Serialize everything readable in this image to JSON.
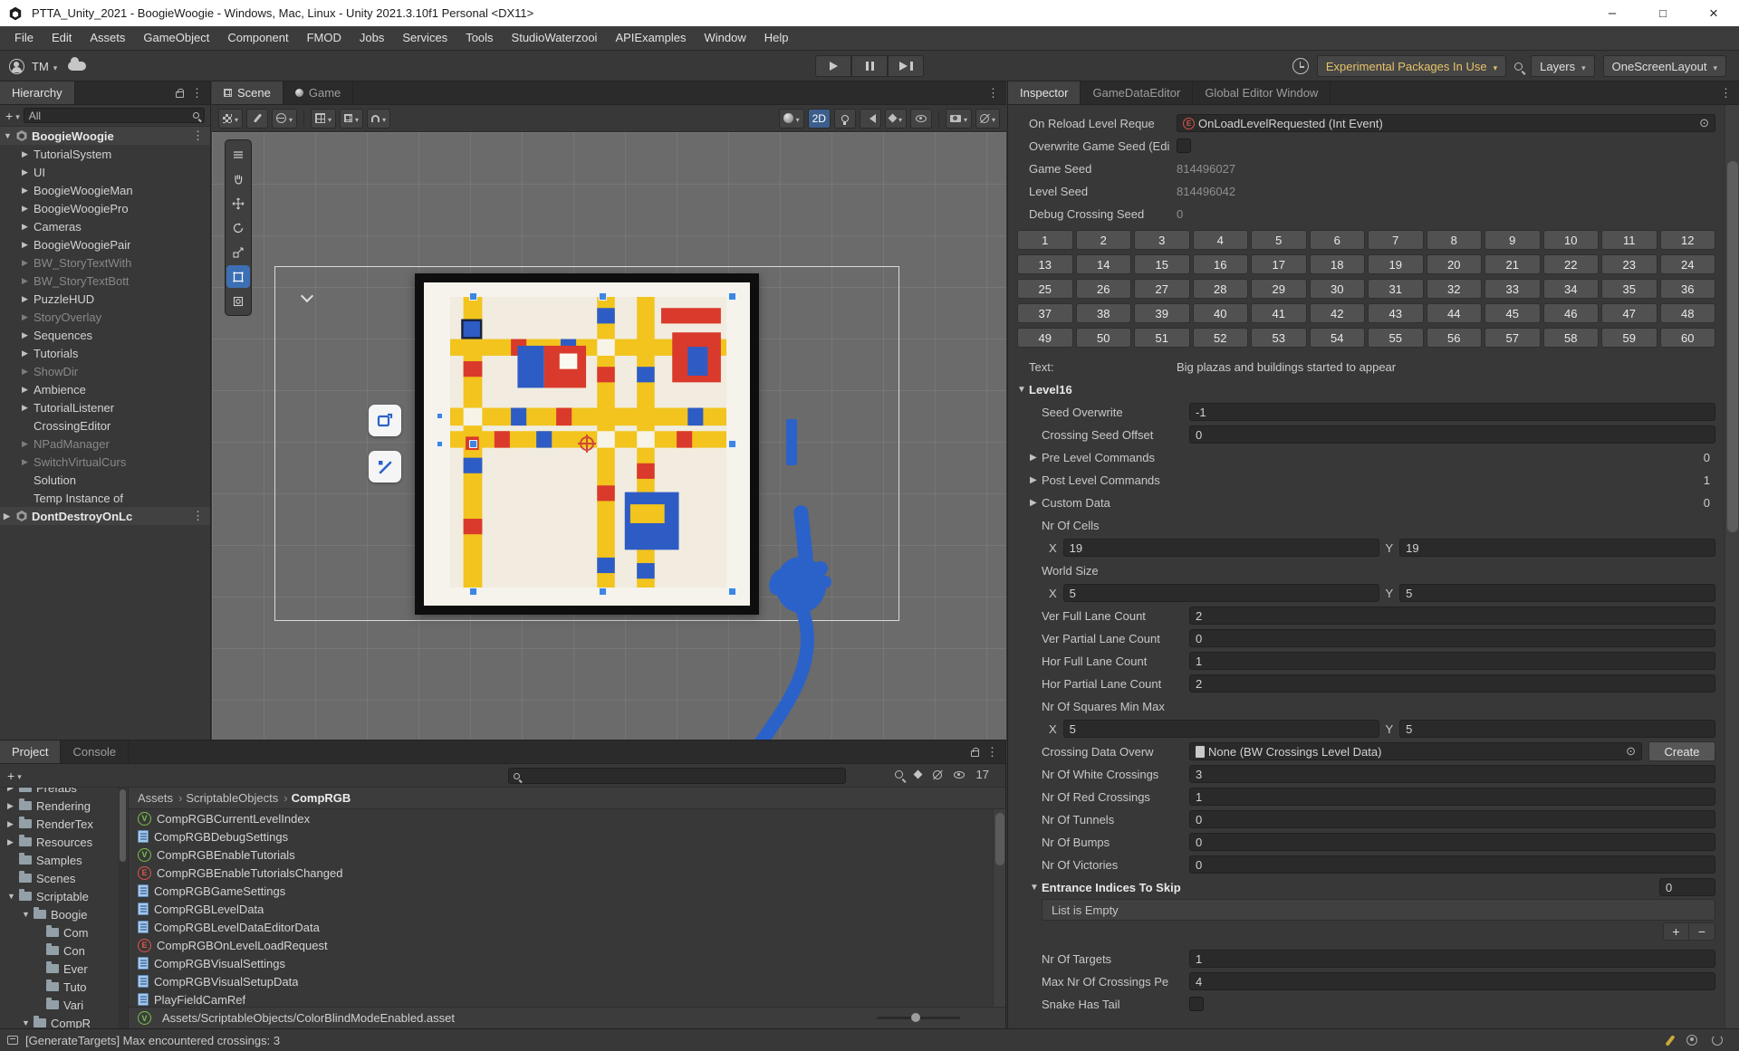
{
  "window": {
    "title": "PTTA_Unity_2021 - BoogieWoogie - Windows, Mac, Linux - Unity 2021.3.10f1 Personal <DX11>"
  },
  "menus": [
    "File",
    "Edit",
    "Assets",
    "GameObject",
    "Component",
    "FMOD",
    "Jobs",
    "Services",
    "Tools",
    "StudioWaterzooi",
    "APIExamples",
    "Window",
    "Help"
  ],
  "toolbar": {
    "account": "TM",
    "packages": "Experimental Packages In Use",
    "layers": "Layers",
    "layout": "OneScreenLayout"
  },
  "hierarchy": {
    "tab": "Hierarchy",
    "filter": "All",
    "items": [
      {
        "label": "BoogieWoogie",
        "depth": "0",
        "arrow": "exp",
        "type": "scene",
        "menu": "⋮"
      },
      {
        "label": "TutorialSystem",
        "depth": "1",
        "arrow": "col"
      },
      {
        "label": "UI",
        "depth": "1",
        "arrow": "col"
      },
      {
        "label": "BoogieWoogieMan",
        "depth": "1",
        "arrow": "col"
      },
      {
        "label": "BoogieWoogiePro",
        "depth": "1",
        "arrow": "col"
      },
      {
        "label": "Cameras",
        "depth": "1",
        "arrow": "col"
      },
      {
        "label": "BoogieWoogiePair",
        "depth": "1",
        "arrow": "col"
      },
      {
        "label": "BW_StoryTextWith",
        "depth": "1",
        "arrow": "col",
        "dim": "1"
      },
      {
        "label": "BW_StoryTextBott",
        "depth": "1",
        "arrow": "col",
        "dim": "1"
      },
      {
        "label": "PuzzleHUD",
        "depth": "1",
        "arrow": "col"
      },
      {
        "label": "StoryOverlay",
        "depth": "1",
        "arrow": "col",
        "dim": "1"
      },
      {
        "label": "Sequences",
        "depth": "1",
        "arrow": "col"
      },
      {
        "label": "Tutorials",
        "depth": "1",
        "arrow": "col"
      },
      {
        "label": "ShowDir",
        "depth": "1",
        "arrow": "col",
        "dim": "1"
      },
      {
        "label": "Ambience",
        "depth": "1",
        "arrow": "col"
      },
      {
        "label": "TutorialListener",
        "depth": "1",
        "arrow": "col"
      },
      {
        "label": "CrossingEditor",
        "depth": "1",
        "arrow": "none"
      },
      {
        "label": "NPadManager",
        "depth": "1",
        "arrow": "col",
        "dim": "1"
      },
      {
        "label": "SwitchVirtualCurs",
        "depth": "1",
        "arrow": "col",
        "dim": "1"
      },
      {
        "label": "Solution",
        "depth": "1",
        "arrow": "none"
      },
      {
        "label": "Temp Instance of",
        "depth": "1",
        "arrow": "none"
      },
      {
        "label": "DontDestroyOnLc",
        "depth": "0",
        "arrow": "col",
        "type": "scene",
        "menu": "⋮"
      }
    ]
  },
  "scene": {
    "tabs": {
      "scene": "Scene",
      "game": "Game"
    },
    "toggle_2d": "2D"
  },
  "project": {
    "tab_project": "Project",
    "tab_console": "Console",
    "hidden_count": "17",
    "breadcrumb": [
      "Assets",
      "ScriptableObjects",
      "CompRGB"
    ],
    "folders": [
      {
        "label": "Prefabs",
        "depth": "0",
        "arrow": "col"
      },
      {
        "label": "Rendering",
        "depth": "0",
        "arrow": "col"
      },
      {
        "label": "RenderTex",
        "depth": "0",
        "arrow": "col"
      },
      {
        "label": "Resources",
        "depth": "0",
        "arrow": "col"
      },
      {
        "label": "Samples",
        "depth": "0",
        "arrow": "none"
      },
      {
        "label": "Scenes",
        "depth": "0",
        "arrow": "none"
      },
      {
        "label": "Scriptable",
        "depth": "0",
        "arrow": "exp"
      },
      {
        "label": "Boogie",
        "depth": "1",
        "arrow": "exp"
      },
      {
        "label": "Com",
        "depth": "2",
        "arrow": "none"
      },
      {
        "label": "Con",
        "depth": "2",
        "arrow": "none"
      },
      {
        "label": "Ever",
        "depth": "2",
        "arrow": "none"
      },
      {
        "label": "Tuto",
        "depth": "2",
        "arrow": "none"
      },
      {
        "label": "Vari",
        "depth": "2",
        "arrow": "none"
      },
      {
        "label": "CompR",
        "depth": "1",
        "arrow": "exp"
      }
    ],
    "files": [
      {
        "name": "CompRGBCurrentLevelIndex",
        "icon": "v"
      },
      {
        "name": "CompRGBDebugSettings",
        "icon": "so"
      },
      {
        "name": "CompRGBEnableTutorials",
        "icon": "v"
      },
      {
        "name": "CompRGBEnableTutorialsChanged",
        "icon": "e"
      },
      {
        "name": "CompRGBGameSettings",
        "icon": "so"
      },
      {
        "name": "CompRGBLevelData",
        "icon": "so"
      },
      {
        "name": "CompRGBLevelDataEditorData",
        "icon": "so"
      },
      {
        "name": "CompRGBOnLevelLoadRequest",
        "icon": "e"
      },
      {
        "name": "CompRGBVisualSettings",
        "icon": "so"
      },
      {
        "name": "CompRGBVisualSetupData",
        "icon": "so"
      },
      {
        "name": "PlayFieldCamRef",
        "icon": "so"
      }
    ],
    "footer_path": "Assets/ScriptableObjects/ColorBlindModeEnabled.asset"
  },
  "inspector": {
    "tabs": [
      {
        "label": "Inspector",
        "sel": "1"
      },
      {
        "label": "GameDataEditor"
      },
      {
        "label": "Global Editor Window"
      }
    ],
    "rows_top": [
      {
        "kind": "event",
        "label": "On Reload Level Reque",
        "value": "OnLoadLevelRequested (Int Event)"
      },
      {
        "kind": "check",
        "label": "Overwrite Game Seed (Edi"
      },
      {
        "kind": "plain",
        "label": "Game Seed",
        "value": "814496027"
      },
      {
        "kind": "plain",
        "label": "Level Seed",
        "value": "814496042"
      },
      {
        "kind": "plain",
        "label": "Debug Crossing Seed",
        "value": "0"
      }
    ],
    "level_buttons": [
      "1",
      "2",
      "3",
      "4",
      "5",
      "6",
      "7",
      "8",
      "9",
      "10",
      "11",
      "12",
      "13",
      "14",
      "15",
      "16",
      "17",
      "18",
      "19",
      "20",
      "21",
      "22",
      "23",
      "24",
      "25",
      "26",
      "27",
      "28",
      "29",
      "30",
      "31",
      "32",
      "33",
      "34",
      "35",
      "36",
      "37",
      "38",
      "39",
      "40",
      "41",
      "42",
      "43",
      "44",
      "45",
      "46",
      "47",
      "48",
      "49",
      "50",
      "51",
      "52",
      "53",
      "54",
      "55",
      "56",
      "57",
      "58",
      "59",
      "60"
    ],
    "rows_main": [
      {
        "kind": "text",
        "label": "Text:",
        "value": "Big plazas and buildings started to appear"
      },
      {
        "kind": "foldout",
        "label": "Level16"
      },
      {
        "kind": "field",
        "label": "Seed Overwrite",
        "value": "-1",
        "indent": "1"
      },
      {
        "kind": "field",
        "label": "Crossing Seed Offset",
        "value": "0",
        "indent": "1"
      },
      {
        "kind": "foldcount",
        "label": "Pre Level Commands",
        "value": "0",
        "indent": "1"
      },
      {
        "kind": "foldcount",
        "label": "Post Level Commands",
        "value": "1",
        "indent": "1"
      },
      {
        "kind": "foldcount",
        "label": "Custom Data",
        "value": "0",
        "indent": "1"
      },
      {
        "kind": "label",
        "label": "Nr Of Cells",
        "indent": "1"
      },
      {
        "kind": "xy",
        "x_label": "X",
        "x": "19",
        "y_label": "Y",
        "y": "19",
        "indent": "2"
      },
      {
        "kind": "label",
        "label": "World Size",
        "indent": "1"
      },
      {
        "kind": "xy",
        "x_label": "X",
        "x": "5",
        "y_label": "Y",
        "y": "5",
        "indent": "2"
      },
      {
        "kind": "field",
        "label": "Ver Full Lane Count",
        "value": "2",
        "indent": "1"
      },
      {
        "kind": "field",
        "label": "Ver Partial Lane Count",
        "value": "0",
        "indent": "1"
      },
      {
        "kind": "field",
        "label": "Hor Full Lane Count",
        "value": "1",
        "indent": "1"
      },
      {
        "kind": "field",
        "label": "Hor Partial Lane Count",
        "value": "2",
        "indent": "1"
      },
      {
        "kind": "label",
        "label": "Nr Of Squares Min Max",
        "indent": "1"
      },
      {
        "kind": "xy",
        "x_label": "X",
        "x": "5",
        "y_label": "Y",
        "y": "5",
        "indent": "2"
      },
      {
        "kind": "object",
        "label": "Crossing Data Overw",
        "value": "None (BW Crossings Level Data)",
        "button": "Create",
        "indent": "1"
      },
      {
        "kind": "field",
        "label": "Nr Of White Crossings",
        "value": "3",
        "indent": "1"
      },
      {
        "kind": "field",
        "label": "Nr Of Red Crossings",
        "value": "1",
        "indent": "1"
      },
      {
        "kind": "field",
        "label": "Nr Of Tunnels",
        "value": "0",
        "indent": "1"
      },
      {
        "kind": "field",
        "label": "Nr Of Bumps",
        "value": "0",
        "indent": "1"
      },
      {
        "kind": "field",
        "label": "Nr Of Victories",
        "value": "0",
        "indent": "1"
      },
      {
        "kind": "boldfold",
        "label": "Entrance Indices To Skip",
        "value": "0",
        "indent": "1"
      },
      {
        "kind": "listempty",
        "value": "List is Empty",
        "indent": "1"
      },
      {
        "kind": "plusminus",
        "add": "+",
        "remove": "−",
        "indent": "1"
      },
      {
        "kind": "field",
        "label": "Nr Of Targets",
        "value": "1",
        "indent": "1"
      },
      {
        "kind": "field",
        "label": "Max Nr Of Crossings Pe",
        "value": "4",
        "indent": "1"
      },
      {
        "kind": "check",
        "label": "Snake Has Tail",
        "indent": "1"
      }
    ]
  },
  "status": {
    "message": "[GenerateTargets] Max encountered crossings: 3"
  }
}
